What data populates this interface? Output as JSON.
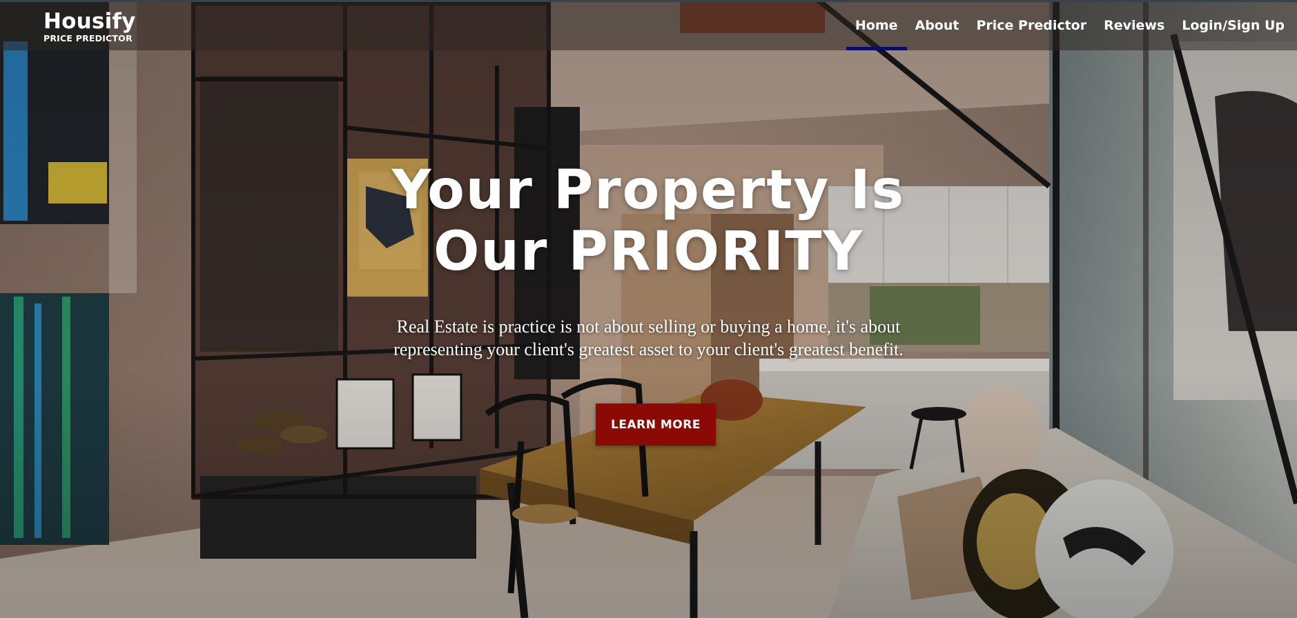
{
  "brand": {
    "name": "Housify",
    "tagline": "PRICE PREDICTOR"
  },
  "nav": {
    "items": [
      {
        "label": "Home",
        "active": true
      },
      {
        "label": "About",
        "active": false
      },
      {
        "label": "Price Predictor",
        "active": false
      },
      {
        "label": "Reviews",
        "active": false
      },
      {
        "label": "Login/Sign Up",
        "active": false
      }
    ]
  },
  "hero": {
    "title_line1": "Your Property Is",
    "title_line2": "Our PRIORITY",
    "subtitle_line1": "Real Estate is practice is not about selling or buying a home, it's about",
    "subtitle_line2": "representing your client's greatest asset to your client's greatest benefit.",
    "cta_label": "LEARN MORE",
    "background_image": "interior-dining-kitchen-photo"
  },
  "colors": {
    "cta": "#8b0a05",
    "nav_active_underline": "#0a0a6a",
    "header_overlay": "rgba(45,38,34,0.55)"
  }
}
